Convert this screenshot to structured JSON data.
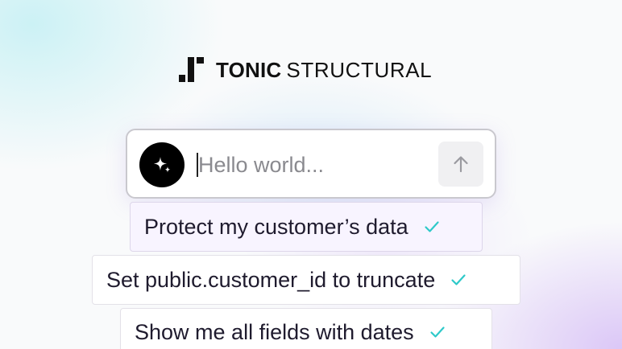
{
  "brand": {
    "name": "TONIC",
    "product": "STRUCTURAL"
  },
  "prompt": {
    "placeholder": "Hello world...",
    "value": ""
  },
  "suggestions": [
    {
      "label": "Protect my customer’s data",
      "checked": true
    },
    {
      "label": "Set public.customer_id to truncate",
      "checked": true
    },
    {
      "label": "Show me all fields with dates",
      "checked": true
    }
  ],
  "icons": {
    "logo": "tonic-logo-icon",
    "assistant": "sparkle-icon",
    "send": "arrow-up-icon",
    "check": "check-icon"
  },
  "colors": {
    "accent_check": "#2ec9c9",
    "avatar_bg": "#000000",
    "selected_suggestion_bg": "#f8f4ff"
  }
}
